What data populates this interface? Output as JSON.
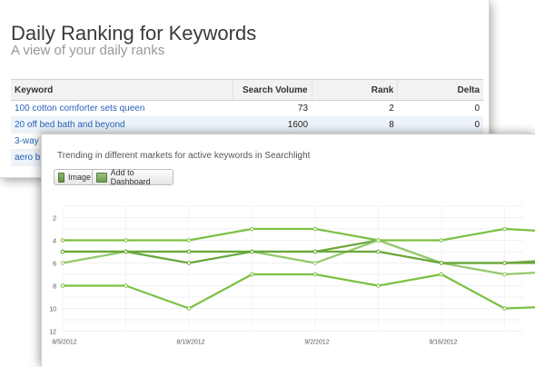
{
  "header": {
    "title": "Daily Ranking for Keywords",
    "subtitle": "A view of your daily ranks"
  },
  "table": {
    "columns": [
      "Keyword",
      "Search Volume",
      "Rank",
      "Delta"
    ],
    "rows": [
      {
        "keyword": "100 cotton comforter sets queen",
        "volume": "73",
        "rank": "2",
        "delta": "0"
      },
      {
        "keyword": "20 off bed bath and beyond",
        "volume": "1600",
        "rank": "8",
        "delta": "0"
      },
      {
        "keyword": "3-way",
        "volume": "",
        "rank": "",
        "delta": ""
      },
      {
        "keyword": "aero b",
        "volume": "",
        "rank": "",
        "delta": ""
      }
    ]
  },
  "panel": {
    "title": "Trending in different markets for active keywords in Searchlight",
    "image_button": "Image",
    "dashboard_button": "Add to Dashboard",
    "image_icon": "image-icon",
    "dashboard_icon": "add-to-dashboard-icon"
  },
  "colors": {
    "link": "#2863b8",
    "series": "#7ac142",
    "series_light": "#93c96a",
    "series_dark": "#6aa83a"
  },
  "chart_data": {
    "type": "line",
    "y_inverted": true,
    "ylim": [
      12,
      1
    ],
    "y_ticks": [
      "2",
      "4",
      "6",
      "8",
      "10",
      "12"
    ],
    "x_tick_labels": [
      "8/5/2012",
      "8/19/2012",
      "9/2/2012",
      "9/16/2012"
    ],
    "x": [
      "8/5/2012",
      "8/12/2012",
      "8/19/2012",
      "8/26/2012",
      "9/2/2012",
      "9/9/2012",
      "9/16/2012",
      "9/23/2012"
    ],
    "grid": "faint",
    "series": [
      {
        "values": [
          4,
          4,
          4,
          3,
          3,
          4,
          4,
          3,
          3.3
        ],
        "color": "#7ac142"
      },
      {
        "values": [
          5,
          5,
          6,
          5,
          5,
          4,
          6,
          6,
          5.7
        ],
        "color": "#6aa83a"
      },
      {
        "values": [
          6,
          5,
          5,
          5,
          6,
          4,
          6,
          7,
          6.7
        ],
        "color": "#93c96a"
      },
      {
        "values": [
          5,
          5,
          5,
          5,
          5,
          5,
          6,
          6,
          6
        ],
        "color": "#6aa83a"
      },
      {
        "values": [
          8,
          8,
          10,
          7,
          7,
          8,
          7,
          10,
          9.8
        ],
        "color": "#7ac142"
      }
    ]
  }
}
